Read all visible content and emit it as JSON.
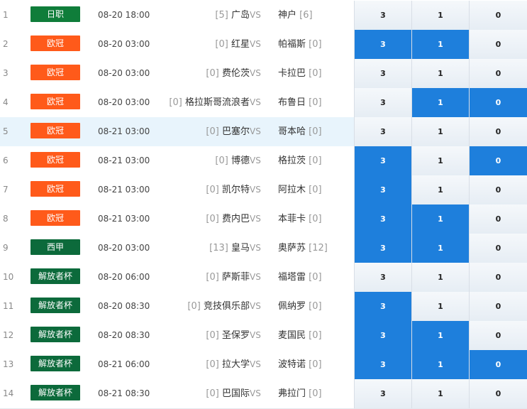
{
  "colors": {
    "日职": "#0f7d3a",
    "欧冠": "#ff5a1a",
    "西甲": "#0c6a3b",
    "解放者杯": "#0c6a3b",
    "selected": "#1e7fdc"
  },
  "matches": [
    {
      "idx": "1",
      "league": "日职",
      "time": "08-20 18:00",
      "home_rank": "[5]",
      "home": "广岛",
      "vs": "VS",
      "away": "神户",
      "away_rank": "[6]",
      "odds": [
        "3",
        "1",
        "0"
      ],
      "selected": [
        false,
        false,
        false
      ],
      "highlight": false
    },
    {
      "idx": "2",
      "league": "欧冠",
      "time": "08-20 03:00",
      "home_rank": "[0]",
      "home": "红星",
      "vs": "VS",
      "away": "帕福斯",
      "away_rank": "[0]",
      "odds": [
        "3",
        "1",
        "0"
      ],
      "selected": [
        true,
        true,
        false
      ],
      "highlight": false
    },
    {
      "idx": "3",
      "league": "欧冠",
      "time": "08-20 03:00",
      "home_rank": "[0]",
      "home": "费伦茨",
      "vs": "VS",
      "away": "卡拉巴",
      "away_rank": "[0]",
      "odds": [
        "3",
        "1",
        "0"
      ],
      "selected": [
        false,
        false,
        false
      ],
      "highlight": false
    },
    {
      "idx": "4",
      "league": "欧冠",
      "time": "08-20 03:00",
      "home_rank": "[0]",
      "home": "格拉斯哥流浪者",
      "vs": "VS",
      "away": "布鲁日",
      "away_rank": "[0]",
      "odds": [
        "3",
        "1",
        "0"
      ],
      "selected": [
        false,
        true,
        true
      ],
      "highlight": false
    },
    {
      "idx": "5",
      "league": "欧冠",
      "time": "08-21 03:00",
      "home_rank": "[0]",
      "home": "巴塞尔",
      "vs": "VS",
      "away": "哥本哈",
      "away_rank": "[0]",
      "odds": [
        "3",
        "1",
        "0"
      ],
      "selected": [
        false,
        false,
        false
      ],
      "highlight": true
    },
    {
      "idx": "6",
      "league": "欧冠",
      "time": "08-21 03:00",
      "home_rank": "[0]",
      "home": "博德",
      "vs": "VS",
      "away": "格拉茨",
      "away_rank": "[0]",
      "odds": [
        "3",
        "1",
        "0"
      ],
      "selected": [
        true,
        false,
        true
      ],
      "highlight": false
    },
    {
      "idx": "7",
      "league": "欧冠",
      "time": "08-21 03:00",
      "home_rank": "[0]",
      "home": "凯尔特",
      "vs": "VS",
      "away": "阿拉木",
      "away_rank": "[0]",
      "odds": [
        "3",
        "1",
        "0"
      ],
      "selected": [
        true,
        false,
        false
      ],
      "highlight": false
    },
    {
      "idx": "8",
      "league": "欧冠",
      "time": "08-21 03:00",
      "home_rank": "[0]",
      "home": "费内巴",
      "vs": "VS",
      "away": "本菲卡",
      "away_rank": "[0]",
      "odds": [
        "3",
        "1",
        "0"
      ],
      "selected": [
        true,
        true,
        false
      ],
      "highlight": false
    },
    {
      "idx": "9",
      "league": "西甲",
      "time": "08-20 03:00",
      "home_rank": "[13]",
      "home": "皇马",
      "vs": "VS",
      "away": "奥萨苏",
      "away_rank": "[12]",
      "odds": [
        "3",
        "1",
        "0"
      ],
      "selected": [
        true,
        true,
        false
      ],
      "highlight": false
    },
    {
      "idx": "10",
      "league": "解放者杯",
      "time": "08-20 06:00",
      "home_rank": "[0]",
      "home": "萨斯菲",
      "vs": "VS",
      "away": "福塔雷",
      "away_rank": "[0]",
      "odds": [
        "3",
        "1",
        "0"
      ],
      "selected": [
        false,
        false,
        false
      ],
      "highlight": false
    },
    {
      "idx": "11",
      "league": "解放者杯",
      "time": "08-20 08:30",
      "home_rank": "[0]",
      "home": "竞技俱乐部",
      "vs": "VS",
      "away": "佩纳罗",
      "away_rank": "[0]",
      "odds": [
        "3",
        "1",
        "0"
      ],
      "selected": [
        true,
        false,
        false
      ],
      "highlight": false
    },
    {
      "idx": "12",
      "league": "解放者杯",
      "time": "08-20 08:30",
      "home_rank": "[0]",
      "home": "圣保罗",
      "vs": "VS",
      "away": "麦国民",
      "away_rank": "[0]",
      "odds": [
        "3",
        "1",
        "0"
      ],
      "selected": [
        true,
        true,
        false
      ],
      "highlight": false
    },
    {
      "idx": "13",
      "league": "解放者杯",
      "time": "08-21 06:00",
      "home_rank": "[0]",
      "home": "拉大学",
      "vs": "VS",
      "away": "波特诺",
      "away_rank": "[0]",
      "odds": [
        "3",
        "1",
        "0"
      ],
      "selected": [
        true,
        true,
        true
      ],
      "highlight": false
    },
    {
      "idx": "14",
      "league": "解放者杯",
      "time": "08-21 08:30",
      "home_rank": "[0]",
      "home": "巴国际",
      "vs": "VS",
      "away": "弗拉门",
      "away_rank": "[0]",
      "odds": [
        "3",
        "1",
        "0"
      ],
      "selected": [
        false,
        false,
        false
      ],
      "highlight": false
    }
  ]
}
